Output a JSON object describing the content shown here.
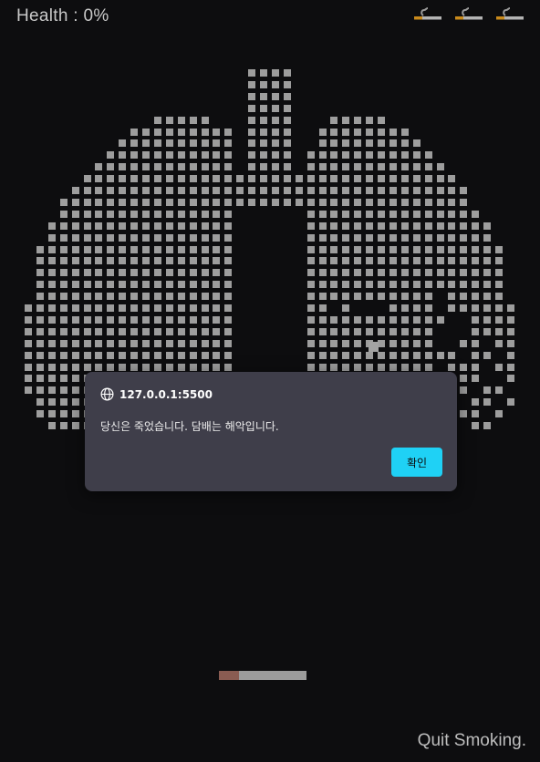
{
  "hud": {
    "health": "Health : 0%"
  },
  "lives": [
    {
      "icon": "cigarette-icon"
    },
    {
      "icon": "cigarette-icon"
    },
    {
      "icon": "cigarette-icon"
    }
  ],
  "paddle": {
    "icon": "cigarette-icon",
    "color": "#9c9c9c",
    "tip_color": "#8a5c52"
  },
  "bricks": {
    "color": "#9d9d9d",
    "shape": "lungs"
  },
  "alert": {
    "origin": "127.0.0.1:5500",
    "origin_icon": "globe-icon",
    "message": "당신은 죽었습니다. 담배는 해악입니다.",
    "ok_label": "확인",
    "ok_color": "#1fd1f5"
  },
  "footer": {
    "title": "Quit Smoking."
  },
  "colors": {
    "background": "#0d0d0f",
    "dialog": "#3f3e4a"
  }
}
